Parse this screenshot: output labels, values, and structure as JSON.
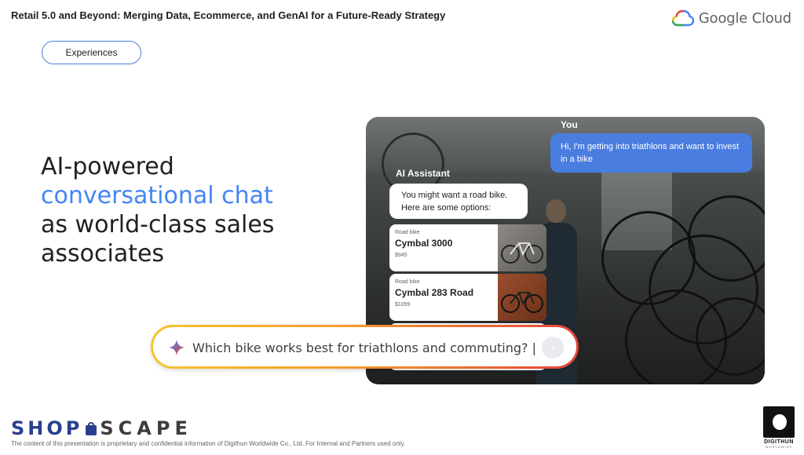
{
  "header": {
    "title": "Retail 5.0 and Beyond: Merging Data, Ecommerce, and GenAI for a Future-Ready Strategy",
    "brand_logo_text": "Google Cloud"
  },
  "pill": {
    "label": "Experiences"
  },
  "headline": {
    "line1": "AI-powered",
    "line2": "conversational chat",
    "line3": "as world-class sales",
    "line4": "associates"
  },
  "chat": {
    "user_label": "You",
    "user_message": "Hi, I'm getting into triathlons and want to invest in a bike",
    "assistant_label": "AI Assistant",
    "assistant_message_line1": "You might want a road bike.",
    "assistant_message_line2": "Here are some options:",
    "products": [
      {
        "type": "Road bike",
        "name": "Cymbal 3000",
        "price": "$945"
      },
      {
        "type": "Road bike",
        "name": "Cymbal 283 Road",
        "price": "$1099"
      }
    ]
  },
  "search": {
    "query": "Which bike works best for triathlons and commuting? |",
    "send_icon": "chevron-right-icon",
    "gradient_colors": [
      "#f4c430",
      "#f39c2a",
      "#e5433b"
    ]
  },
  "footer": {
    "brand_shop": "SHOP",
    "brand_scape": "SCAPE",
    "note": "The content of this presentation is proprietary and confidential information of Digithun Worldwide Co., Ltd. For Internal and Partners used only.",
    "corner_logo_name": "DIGITHUN",
    "corner_logo_sub": "WORLDWIDE"
  },
  "colors": {
    "accent_blue": "#4285f4",
    "user_bubble": "#4a7de0",
    "brand_navy": "#2a3f8f"
  }
}
